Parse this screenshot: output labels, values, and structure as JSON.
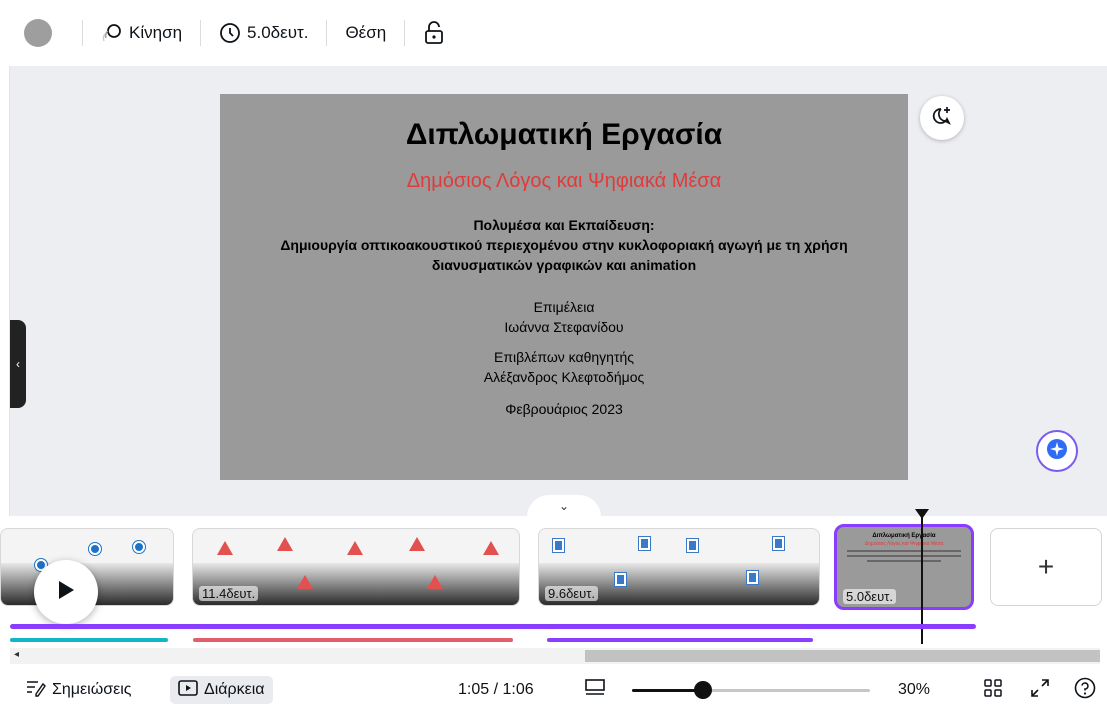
{
  "toolbar": {
    "animate_label": "Κίνηση",
    "duration_label": "5.0δευτ.",
    "position_label": "Θέση"
  },
  "slide": {
    "title": "Διπλωματική Εργασία",
    "subtitle": "Δημόσιος Λόγος και Ψηφιακά Μέσα",
    "topic_line1": "Πολυμέσα  και Εκπαίδευση:",
    "topic_line2": "Δημιουργία οπτικοακουστικού περιεχομένου στην κυκλοφοριακή αγωγή με τη χρήση",
    "topic_line3": "διανυσματικών γραφικών και animation",
    "editor_label": "Επιμέλεια",
    "editor_name": "Ιωάννα Στεφανίδου",
    "supervisor_label": "Επιβλέπων καθηγητής",
    "supervisor_name": "Αλέξανδρος Κλεφτοδήμος",
    "date": "Φεβρουάριος 2023"
  },
  "timeline": {
    "clips": [
      {
        "duration": ""
      },
      {
        "duration": "11.4δευτ."
      },
      {
        "duration": "9.6δευτ."
      },
      {
        "duration": "5.0δευτ."
      }
    ],
    "add_label": "+"
  },
  "bottombar": {
    "notes_label": "Σημειώσεις",
    "duration_label": "Διάρκεια",
    "time_readout": "1:05 / 1:06",
    "zoom_value": 0.3,
    "zoom_label": "30%"
  },
  "colors": {
    "accent": "#8b3dff",
    "slide_bg": "#9a9a9a",
    "subtitle_red": "#e23a3a",
    "audio_teal": "#13b5c8",
    "audio_red": "#e25f6a"
  }
}
